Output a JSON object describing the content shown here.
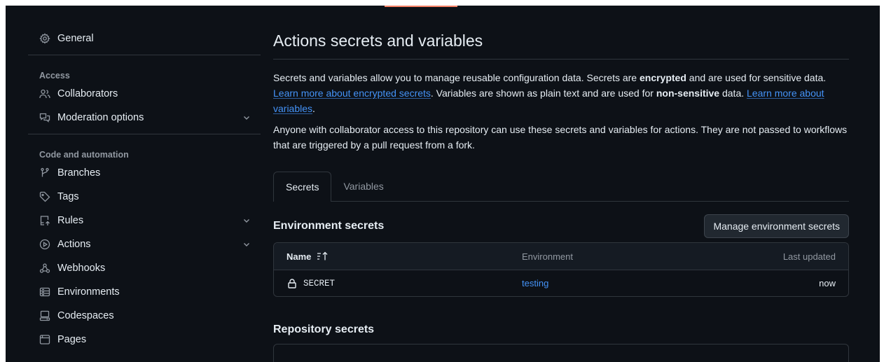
{
  "sidebar": {
    "general": {
      "label": "General",
      "icon": "gear-icon"
    },
    "access_heading": "Access",
    "access_items": [
      {
        "label": "Collaborators",
        "icon": "people-icon"
      },
      {
        "label": "Moderation options",
        "icon": "comment-discussion-icon"
      }
    ],
    "code_heading": "Code and automation",
    "code_items": [
      {
        "label": "Branches",
        "icon": "git-branch-icon"
      },
      {
        "label": "Tags",
        "icon": "tag-icon"
      },
      {
        "label": "Rules",
        "icon": "repo-push-icon"
      },
      {
        "label": "Actions",
        "icon": "play-icon"
      },
      {
        "label": "Webhooks",
        "icon": "webhook-icon"
      },
      {
        "label": "Environments",
        "icon": "server-icon"
      },
      {
        "label": "Codespaces",
        "icon": "codespaces-icon"
      },
      {
        "label": "Pages",
        "icon": "browser-icon"
      }
    ]
  },
  "main": {
    "title": "Actions secrets and variables",
    "para1": {
      "t1": "Secrets and variables allow you to manage reusable configuration data. Secrets are ",
      "b1": "encrypted",
      "t2": " and are used for sensitive data. ",
      "link1": "Learn more about encrypted secrets",
      "t3": ". Variables are shown as plain text and are used for ",
      "b2": "non-sensitive",
      "t4": " data. ",
      "link2": "Learn more about variables",
      "t5": "."
    },
    "para2": "Anyone with collaborator access to this repository can use these secrets and variables for actions. They are not passed to workflows that are triggered by a pull request from a fork.",
    "tabs": [
      {
        "label": "Secrets",
        "active": true
      },
      {
        "label": "Variables",
        "active": false
      }
    ],
    "env_secrets": {
      "title": "Environment secrets",
      "manage_button": "Manage environment secrets",
      "columns": {
        "name": "Name",
        "environment": "Environment",
        "updated": "Last updated"
      },
      "rows": [
        {
          "name": "SECRET",
          "environment": "testing",
          "updated": "now"
        }
      ]
    },
    "repo_secrets": {
      "title": "Repository secrets"
    }
  },
  "colors": {
    "background": "#0d1117",
    "text": "#e6edf3",
    "muted": "#9198a1",
    "border": "#30363d",
    "link": "#4493f8",
    "accent": "#f78166"
  }
}
